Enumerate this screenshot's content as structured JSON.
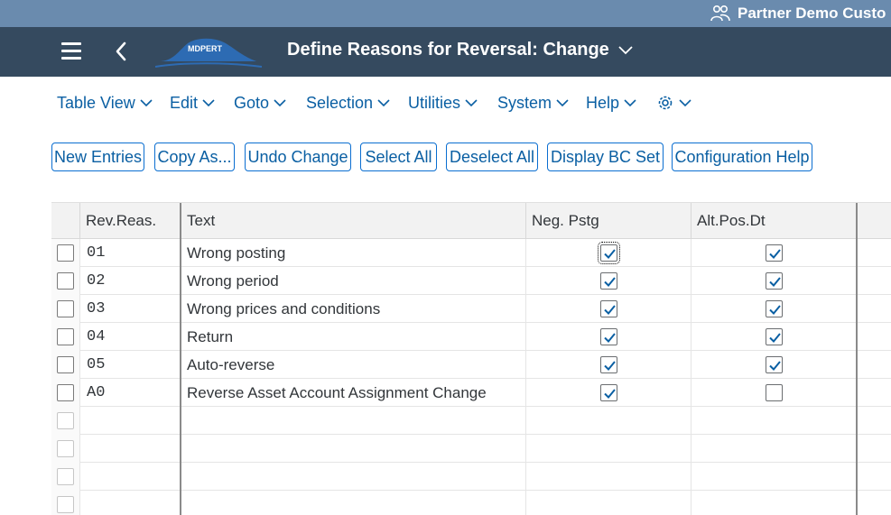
{
  "user": {
    "name": "Partner Demo Custo",
    "icon": "users-icon"
  },
  "shell": {
    "logo_text": "MDPERT",
    "title": "Define Reasons for Reversal: Change"
  },
  "menu": [
    {
      "label": "Table View"
    },
    {
      "label": "Edit"
    },
    {
      "label": "Goto"
    },
    {
      "label": "Selection"
    },
    {
      "label": "Utilities"
    },
    {
      "label": "System"
    },
    {
      "label": "Help"
    }
  ],
  "toolbar": [
    {
      "label": "New Entries"
    },
    {
      "label": "Copy As..."
    },
    {
      "label": "Undo Change"
    },
    {
      "label": "Select All"
    },
    {
      "label": "Deselect All"
    },
    {
      "label": "Display BC Set"
    },
    {
      "label": "Configuration Help"
    }
  ],
  "table": {
    "columns": [
      "Rev.Reas.",
      "Text",
      "Neg. Pstg",
      "Alt.Pos.Dt"
    ],
    "rows": [
      {
        "code": "01",
        "text": "Wrong posting",
        "neg": true,
        "alt": true
      },
      {
        "code": "02",
        "text": "Wrong period",
        "neg": true,
        "alt": true
      },
      {
        "code": "03",
        "text": "Wrong prices and conditions",
        "neg": true,
        "alt": true
      },
      {
        "code": "04",
        "text": "Return",
        "neg": true,
        "alt": true
      },
      {
        "code": "05",
        "text": "Auto-reverse",
        "neg": true,
        "alt": true
      },
      {
        "code": "A0",
        "text": "Reverse Asset Account Assignment Change",
        "neg": true,
        "alt": false
      }
    ],
    "empty_rows": 4
  },
  "colors": {
    "shell": "#354a5f",
    "topstrip": "#6a8bae",
    "link": "#0a5fa3",
    "check": "#0a5fa3"
  }
}
